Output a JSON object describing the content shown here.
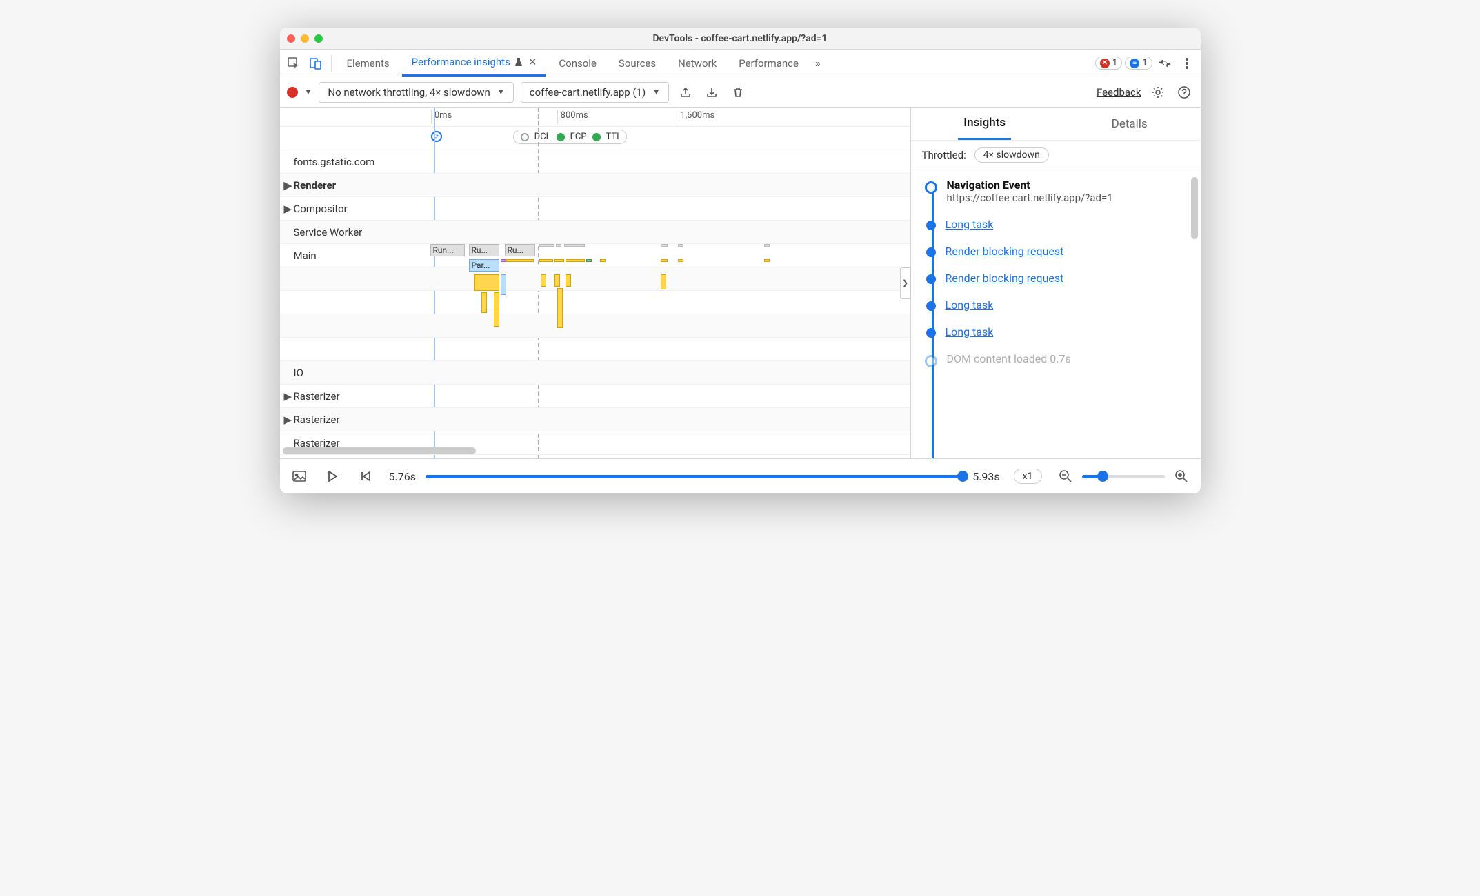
{
  "window": {
    "title": "DevTools - coffee-cart.netlify.app/?ad=1"
  },
  "tabs": {
    "items": [
      "Elements",
      "Performance insights",
      "Console",
      "Sources",
      "Network",
      "Performance"
    ],
    "active_index": 1,
    "close_glyph": "✕",
    "more_glyph": "»",
    "errors_count": "1",
    "messages_count": "1"
  },
  "toolbar": {
    "throttling": "No network throttling, 4× slowdown",
    "page": "coffee-cart.netlify.app (1)",
    "feedback": "Feedback"
  },
  "axis": {
    "ticks": [
      {
        "label": "0ms",
        "left_pct": 24
      },
      {
        "label": "800ms",
        "left_pct": 44
      },
      {
        "label": "1,600ms",
        "left_pct": 63
      }
    ]
  },
  "markers": {
    "nav_left_pct": 24,
    "pill_left_pct": 37,
    "items": [
      {
        "label": "DCL",
        "color": "#9aa0a6"
      },
      {
        "label": "FCP",
        "color": "#34a853"
      },
      {
        "label": "TTI",
        "color": "#34a853"
      }
    ]
  },
  "tracks": [
    {
      "label": "fonts.gstatic.com",
      "caret": "",
      "header": false
    },
    {
      "label": "Renderer",
      "caret": "▶",
      "header": true
    },
    {
      "label": "Compositor",
      "caret": "▶",
      "header": false
    },
    {
      "label": "Service Worker",
      "caret": "",
      "header": false
    },
    {
      "label": "Main",
      "caret": "",
      "header": false
    },
    {
      "label": "",
      "caret": "",
      "header": false
    },
    {
      "label": "",
      "caret": "",
      "header": false
    },
    {
      "label": "",
      "caret": "",
      "header": false
    },
    {
      "label": "",
      "caret": "",
      "header": false
    },
    {
      "label": "IO",
      "caret": "",
      "header": false
    },
    {
      "label": "Rasterizer",
      "caret": "▶",
      "header": false
    },
    {
      "label": "Rasterizer",
      "caret": "▶",
      "header": false
    },
    {
      "label": "Rasterizer",
      "caret": "",
      "header": false
    }
  ],
  "flame_labels": {
    "run1": "Run...",
    "run2": "Ru...",
    "run3": "Ru...",
    "par": "Par..."
  },
  "right": {
    "tabs": {
      "insights": "Insights",
      "details": "Details"
    },
    "throttled_label": "Throttled:",
    "throttled_value": "4× slowdown",
    "nav_title": "Navigation Event",
    "nav_url": "https://coffee-cart.netlify.app/?ad=1",
    "events": [
      "Long task",
      "Render blocking request",
      "Render blocking request",
      "Long task",
      "Long task"
    ],
    "cutoff": "DOM content loaded 0.7s"
  },
  "footer": {
    "time_start": "5.76s",
    "time_end": "5.93s",
    "speed": "x1"
  }
}
